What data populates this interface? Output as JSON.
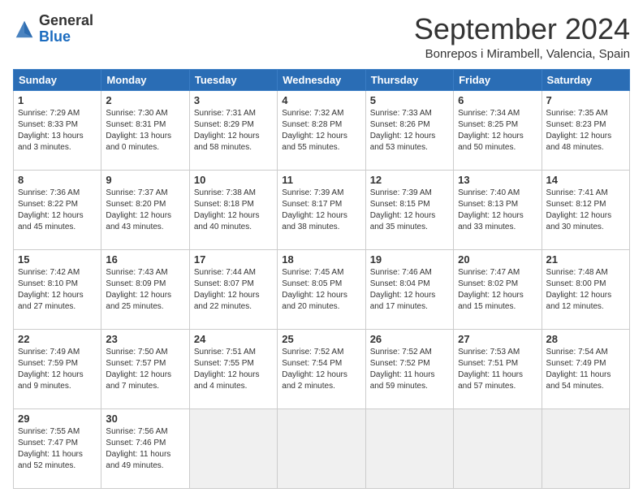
{
  "header": {
    "logo_general": "General",
    "logo_blue": "Blue",
    "month_title": "September 2024",
    "location": "Bonrepos i Mirambell, Valencia, Spain"
  },
  "days_of_week": [
    "Sunday",
    "Monday",
    "Tuesday",
    "Wednesday",
    "Thursday",
    "Friday",
    "Saturday"
  ],
  "weeks": [
    [
      {
        "day": "1",
        "sunrise": "Sunrise: 7:29 AM",
        "sunset": "Sunset: 8:33 PM",
        "daylight": "Daylight: 13 hours and 3 minutes."
      },
      {
        "day": "2",
        "sunrise": "Sunrise: 7:30 AM",
        "sunset": "Sunset: 8:31 PM",
        "daylight": "Daylight: 13 hours and 0 minutes."
      },
      {
        "day": "3",
        "sunrise": "Sunrise: 7:31 AM",
        "sunset": "Sunset: 8:29 PM",
        "daylight": "Daylight: 12 hours and 58 minutes."
      },
      {
        "day": "4",
        "sunrise": "Sunrise: 7:32 AM",
        "sunset": "Sunset: 8:28 PM",
        "daylight": "Daylight: 12 hours and 55 minutes."
      },
      {
        "day": "5",
        "sunrise": "Sunrise: 7:33 AM",
        "sunset": "Sunset: 8:26 PM",
        "daylight": "Daylight: 12 hours and 53 minutes."
      },
      {
        "day": "6",
        "sunrise": "Sunrise: 7:34 AM",
        "sunset": "Sunset: 8:25 PM",
        "daylight": "Daylight: 12 hours and 50 minutes."
      },
      {
        "day": "7",
        "sunrise": "Sunrise: 7:35 AM",
        "sunset": "Sunset: 8:23 PM",
        "daylight": "Daylight: 12 hours and 48 minutes."
      }
    ],
    [
      {
        "day": "8",
        "sunrise": "Sunrise: 7:36 AM",
        "sunset": "Sunset: 8:22 PM",
        "daylight": "Daylight: 12 hours and 45 minutes."
      },
      {
        "day": "9",
        "sunrise": "Sunrise: 7:37 AM",
        "sunset": "Sunset: 8:20 PM",
        "daylight": "Daylight: 12 hours and 43 minutes."
      },
      {
        "day": "10",
        "sunrise": "Sunrise: 7:38 AM",
        "sunset": "Sunset: 8:18 PM",
        "daylight": "Daylight: 12 hours and 40 minutes."
      },
      {
        "day": "11",
        "sunrise": "Sunrise: 7:39 AM",
        "sunset": "Sunset: 8:17 PM",
        "daylight": "Daylight: 12 hours and 38 minutes."
      },
      {
        "day": "12",
        "sunrise": "Sunrise: 7:39 AM",
        "sunset": "Sunset: 8:15 PM",
        "daylight": "Daylight: 12 hours and 35 minutes."
      },
      {
        "day": "13",
        "sunrise": "Sunrise: 7:40 AM",
        "sunset": "Sunset: 8:13 PM",
        "daylight": "Daylight: 12 hours and 33 minutes."
      },
      {
        "day": "14",
        "sunrise": "Sunrise: 7:41 AM",
        "sunset": "Sunset: 8:12 PM",
        "daylight": "Daylight: 12 hours and 30 minutes."
      }
    ],
    [
      {
        "day": "15",
        "sunrise": "Sunrise: 7:42 AM",
        "sunset": "Sunset: 8:10 PM",
        "daylight": "Daylight: 12 hours and 27 minutes."
      },
      {
        "day": "16",
        "sunrise": "Sunrise: 7:43 AM",
        "sunset": "Sunset: 8:09 PM",
        "daylight": "Daylight: 12 hours and 25 minutes."
      },
      {
        "day": "17",
        "sunrise": "Sunrise: 7:44 AM",
        "sunset": "Sunset: 8:07 PM",
        "daylight": "Daylight: 12 hours and 22 minutes."
      },
      {
        "day": "18",
        "sunrise": "Sunrise: 7:45 AM",
        "sunset": "Sunset: 8:05 PM",
        "daylight": "Daylight: 12 hours and 20 minutes."
      },
      {
        "day": "19",
        "sunrise": "Sunrise: 7:46 AM",
        "sunset": "Sunset: 8:04 PM",
        "daylight": "Daylight: 12 hours and 17 minutes."
      },
      {
        "day": "20",
        "sunrise": "Sunrise: 7:47 AM",
        "sunset": "Sunset: 8:02 PM",
        "daylight": "Daylight: 12 hours and 15 minutes."
      },
      {
        "day": "21",
        "sunrise": "Sunrise: 7:48 AM",
        "sunset": "Sunset: 8:00 PM",
        "daylight": "Daylight: 12 hours and 12 minutes."
      }
    ],
    [
      {
        "day": "22",
        "sunrise": "Sunrise: 7:49 AM",
        "sunset": "Sunset: 7:59 PM",
        "daylight": "Daylight: 12 hours and 9 minutes."
      },
      {
        "day": "23",
        "sunrise": "Sunrise: 7:50 AM",
        "sunset": "Sunset: 7:57 PM",
        "daylight": "Daylight: 12 hours and 7 minutes."
      },
      {
        "day": "24",
        "sunrise": "Sunrise: 7:51 AM",
        "sunset": "Sunset: 7:55 PM",
        "daylight": "Daylight: 12 hours and 4 minutes."
      },
      {
        "day": "25",
        "sunrise": "Sunrise: 7:52 AM",
        "sunset": "Sunset: 7:54 PM",
        "daylight": "Daylight: 12 hours and 2 minutes."
      },
      {
        "day": "26",
        "sunrise": "Sunrise: 7:52 AM",
        "sunset": "Sunset: 7:52 PM",
        "daylight": "Daylight: 11 hours and 59 minutes."
      },
      {
        "day": "27",
        "sunrise": "Sunrise: 7:53 AM",
        "sunset": "Sunset: 7:51 PM",
        "daylight": "Daylight: 11 hours and 57 minutes."
      },
      {
        "day": "28",
        "sunrise": "Sunrise: 7:54 AM",
        "sunset": "Sunset: 7:49 PM",
        "daylight": "Daylight: 11 hours and 54 minutes."
      }
    ],
    [
      {
        "day": "29",
        "sunrise": "Sunrise: 7:55 AM",
        "sunset": "Sunset: 7:47 PM",
        "daylight": "Daylight: 11 hours and 52 minutes."
      },
      {
        "day": "30",
        "sunrise": "Sunrise: 7:56 AM",
        "sunset": "Sunset: 7:46 PM",
        "daylight": "Daylight: 11 hours and 49 minutes."
      },
      null,
      null,
      null,
      null,
      null
    ]
  ]
}
